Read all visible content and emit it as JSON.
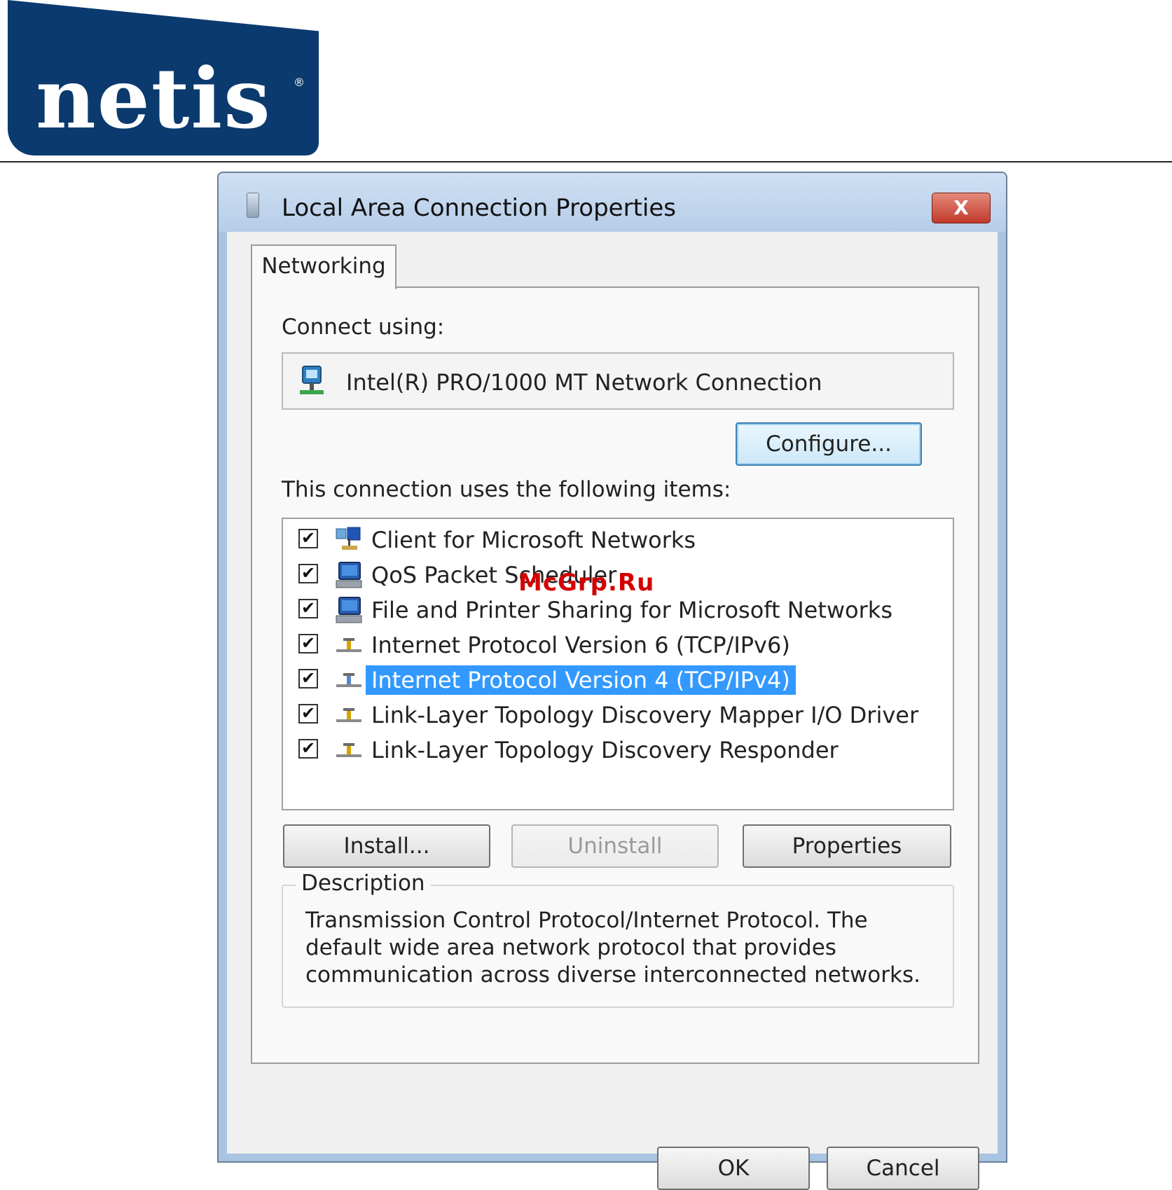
{
  "brand": {
    "logo_text": "netis",
    "logo_reg": "®",
    "color": "#0b3a6e"
  },
  "window": {
    "title": "Local Area Connection Properties",
    "close_label": "X"
  },
  "tab": {
    "label": "Networking"
  },
  "connect_using": {
    "label": "Connect using:",
    "adapter": "Intel(R) PRO/1000 MT Network Connection",
    "configure_label": "Configure..."
  },
  "items_section": {
    "label": "This connection uses the following items:",
    "items": [
      {
        "label": "Client for Microsoft Networks",
        "checked": "✔"
      },
      {
        "label": "QoS Packet Scheduler",
        "checked": "✔"
      },
      {
        "label": "File and Printer Sharing for Microsoft Networks",
        "checked": "✔"
      },
      {
        "label": "Internet Protocol Version 6 (TCP/IPv6)",
        "checked": "✔"
      },
      {
        "label": "Internet Protocol Version 4 (TCP/IPv4)",
        "checked": "✔"
      },
      {
        "label": "Link-Layer Topology Discovery Mapper I/O Driver",
        "checked": "✔"
      },
      {
        "label": "Link-Layer Topology Discovery Responder",
        "checked": "✔"
      }
    ],
    "selected_color": "#3399ff"
  },
  "actions": {
    "install": "Install...",
    "uninstall": "Uninstall",
    "properties": "Properties"
  },
  "description": {
    "legend": "Description",
    "text": "Transmission Control Protocol/Internet Protocol. The default wide area network protocol that provides communication across diverse interconnected networks."
  },
  "footer": {
    "ok": "OK",
    "cancel": "Cancel"
  },
  "watermark": "McGrp.Ru"
}
